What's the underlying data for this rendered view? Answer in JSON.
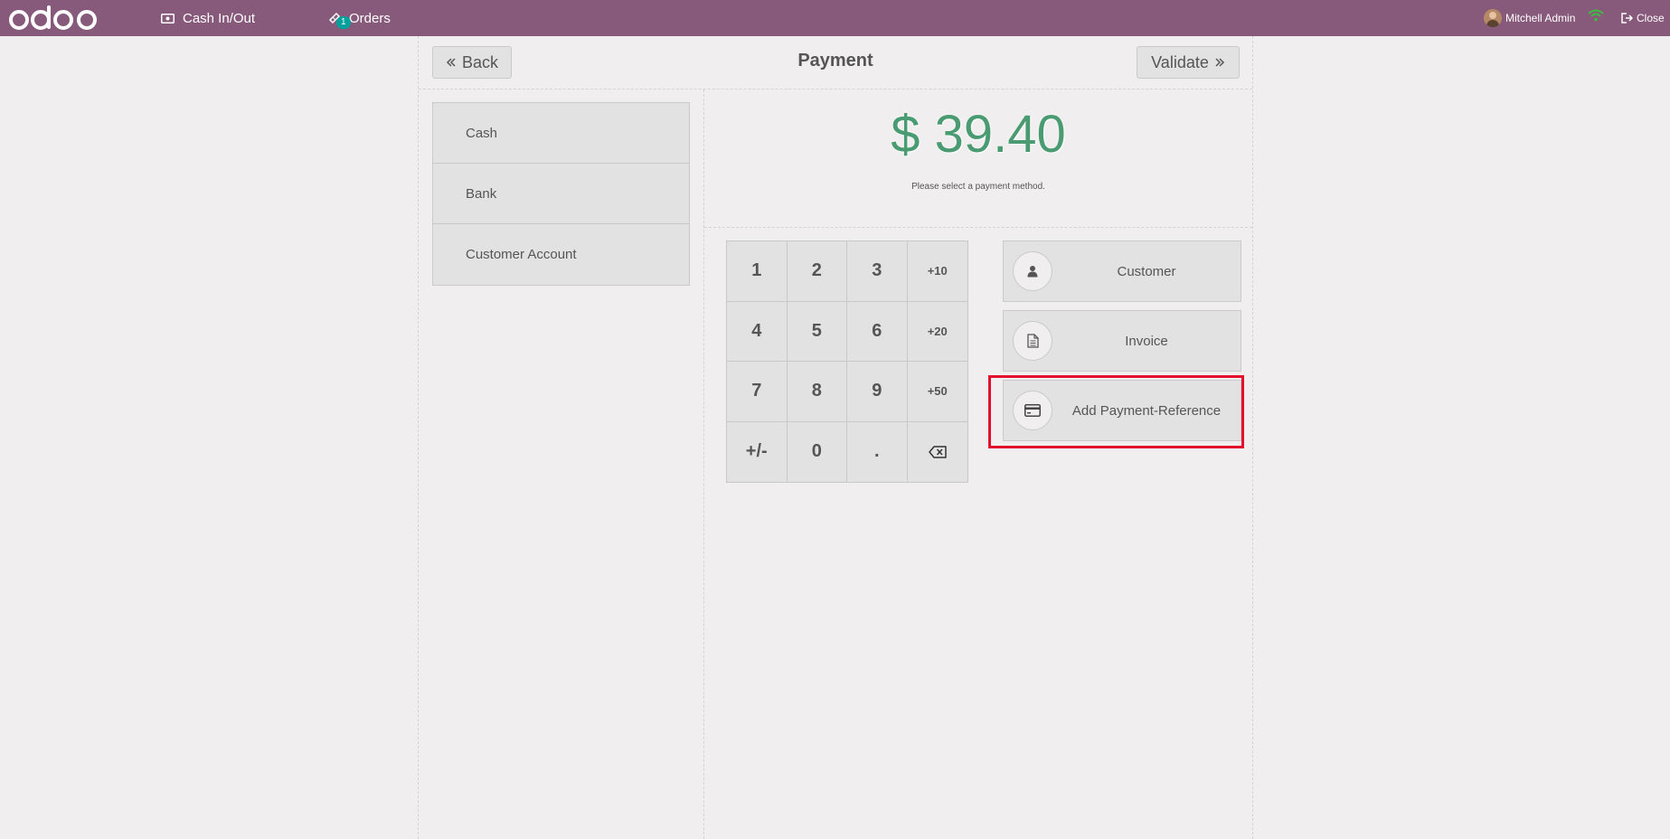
{
  "topbar": {
    "logo_text": "odoo",
    "cash_in_out": "Cash In/Out",
    "orders": "Orders",
    "orders_badge": "1",
    "user_name": "Mitchell Admin",
    "close": "Close",
    "bar_color": "#875a7b",
    "wifi_color": "#3fbd3f"
  },
  "payment": {
    "title": "Payment",
    "back_label": "Back",
    "validate_label": "Validate",
    "total": "$ 39.40",
    "hint": "Please select a payment method.",
    "total_color": "#4a9b72"
  },
  "methods": [
    {
      "label": "Cash"
    },
    {
      "label": "Bank"
    },
    {
      "label": "Customer Account"
    }
  ],
  "numpad": {
    "keys": [
      "1",
      "2",
      "3",
      "+10",
      "4",
      "5",
      "6",
      "+20",
      "7",
      "8",
      "9",
      "+50",
      "+/-",
      "0",
      ".",
      ""
    ]
  },
  "actions": [
    {
      "label": "Customer",
      "icon": "user-icon"
    },
    {
      "label": "Invoice",
      "icon": "file-icon"
    },
    {
      "label": "Add Payment-Reference",
      "icon": "credit-card-icon"
    }
  ]
}
